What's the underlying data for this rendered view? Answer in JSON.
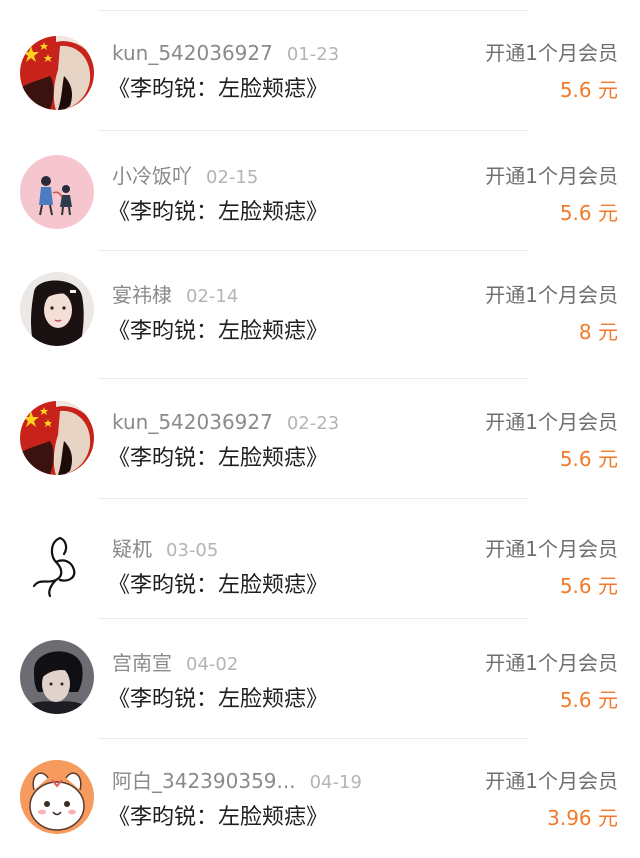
{
  "items": [
    {
      "username": "kun_542036927",
      "date": "01-23",
      "title": "《李昀锐：左脸颊痣》",
      "action": "开通1个月会员",
      "price": "5.6",
      "currency": "元",
      "avatar": "avatar-flag"
    },
    {
      "username": "小冷饭吖",
      "date": "02-15",
      "title": "《李昀锐：左脸颊痣》",
      "action": "开通1个月会员",
      "price": "5.6",
      "currency": "元",
      "avatar": "avatar-pink-couple"
    },
    {
      "username": "宴祎棣",
      "date": "02-14",
      "title": "《李昀锐：左脸颊痣》",
      "action": "开通1个月会员",
      "price": "8",
      "currency": "元",
      "avatar": "avatar-girl-portrait"
    },
    {
      "username": "kun_542036927",
      "date": "02-23",
      "title": "《李昀锐：左脸颊痣》",
      "action": "开通1个月会员",
      "price": "5.6",
      "currency": "元",
      "avatar": "avatar-flag"
    },
    {
      "username": "疑杌",
      "date": "03-05",
      "title": "《李昀锐：左脸颊痣》",
      "action": "开通1个月会员",
      "price": "5.6",
      "currency": "元",
      "avatar": "avatar-line-doodle"
    },
    {
      "username": "宫南宣",
      "date": "04-02",
      "title": "《李昀锐：左脸颊痣》",
      "action": "开通1个月会员",
      "price": "5.6",
      "currency": "元",
      "avatar": "avatar-dark-portrait"
    },
    {
      "username": "阿白_342390359...",
      "date": "04-19",
      "title": "《李昀锐：左脸颊痣》",
      "action": "开通1个月会员",
      "price": "3.96",
      "currency": "元",
      "avatar": "avatar-cartoon-dog"
    }
  ],
  "colors": {
    "price": "#f27a2a",
    "username": "#8a8a8a",
    "date": "#b4b4b4",
    "title": "#1f1f1f",
    "action": "#6f6f6f"
  }
}
